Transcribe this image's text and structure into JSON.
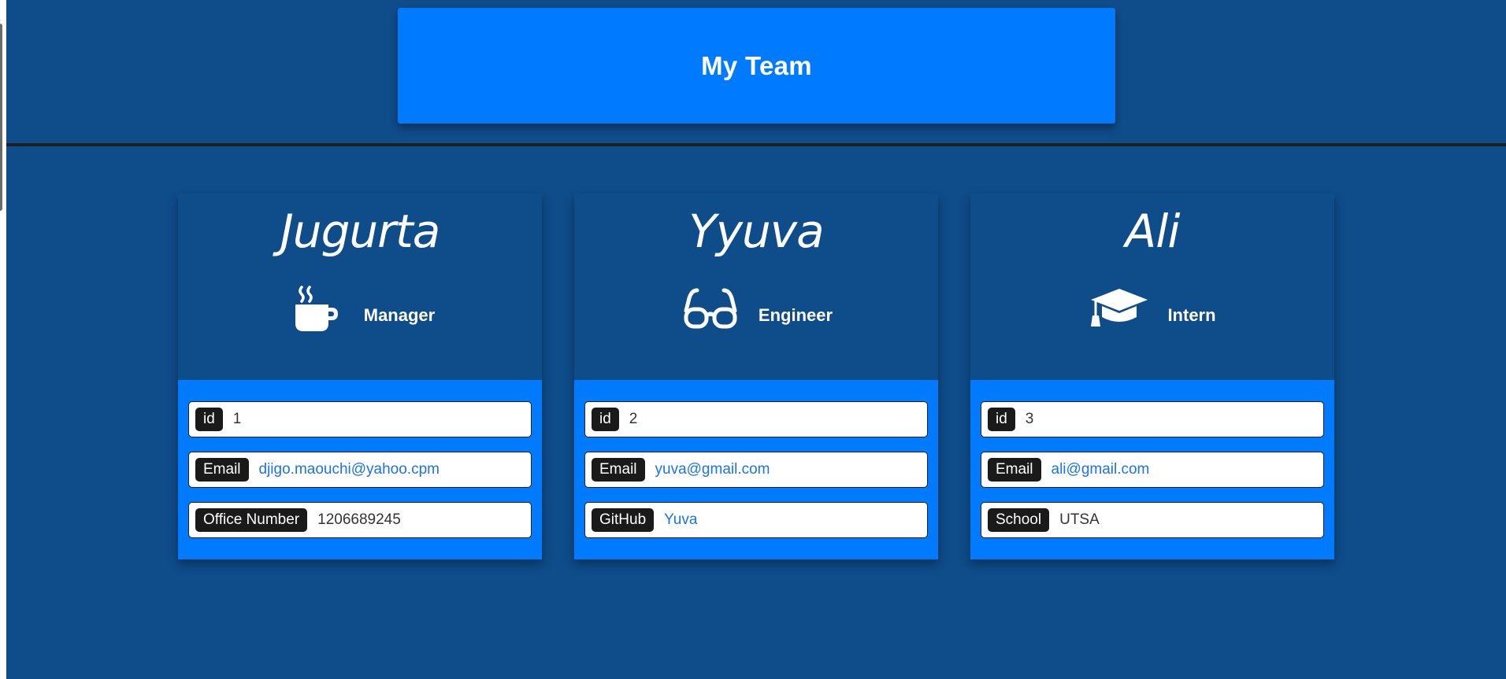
{
  "header": {
    "title": "My Team"
  },
  "colors": {
    "page_bg": "#0f4c8a",
    "header_bg": "#007bff",
    "card_bottom_bg": "#007bff",
    "badge_bg": "#1a1a1a",
    "link": "#1a73e8"
  },
  "cards": [
    {
      "name": "Jugurta",
      "role": "Manager",
      "icon": "coffee-mug-icon",
      "fields": [
        {
          "label": "id",
          "value": "1"
        },
        {
          "label": "Email",
          "value": "djigo.maouchi@yahoo.cpm"
        },
        {
          "label": "Office Number",
          "value": "1206689245"
        }
      ]
    },
    {
      "name": "Yyuva",
      "role": "Engineer",
      "icon": "glasses-icon",
      "fields": [
        {
          "label": "id",
          "value": "2"
        },
        {
          "label": "Email",
          "value": "yuva@gmail.com"
        },
        {
          "label": "GitHub",
          "value": "Yuva"
        }
      ]
    },
    {
      "name": "Ali",
      "role": "Intern",
      "icon": "graduation-cap-icon",
      "fields": [
        {
          "label": "id",
          "value": "3"
        },
        {
          "label": "Email",
          "value": "ali@gmail.com"
        },
        {
          "label": "School",
          "value": "UTSA"
        }
      ]
    }
  ]
}
